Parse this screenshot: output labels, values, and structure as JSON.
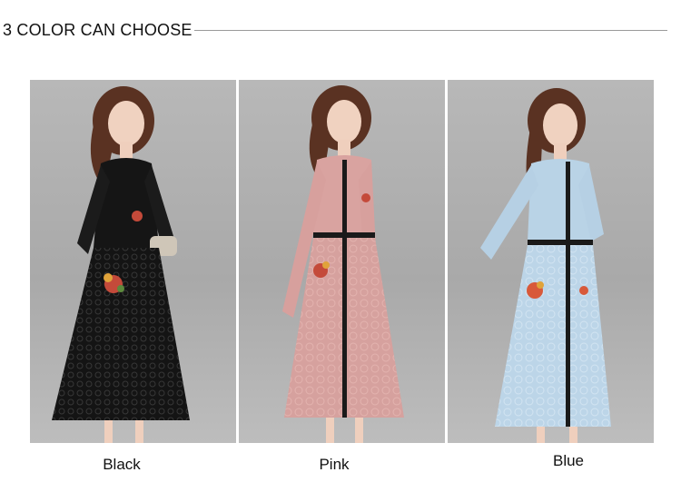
{
  "header": {
    "title": "3 COLOR CAN CHOOSE"
  },
  "variants": [
    {
      "label": "Black",
      "color": "#111111",
      "accent": "#c44a3a"
    },
    {
      "label": "Pink",
      "color": "#d9a3a0",
      "accent": "#c44a3a"
    },
    {
      "label": "Blue",
      "color": "#b9d3e6",
      "accent": "#d8593a"
    }
  ]
}
